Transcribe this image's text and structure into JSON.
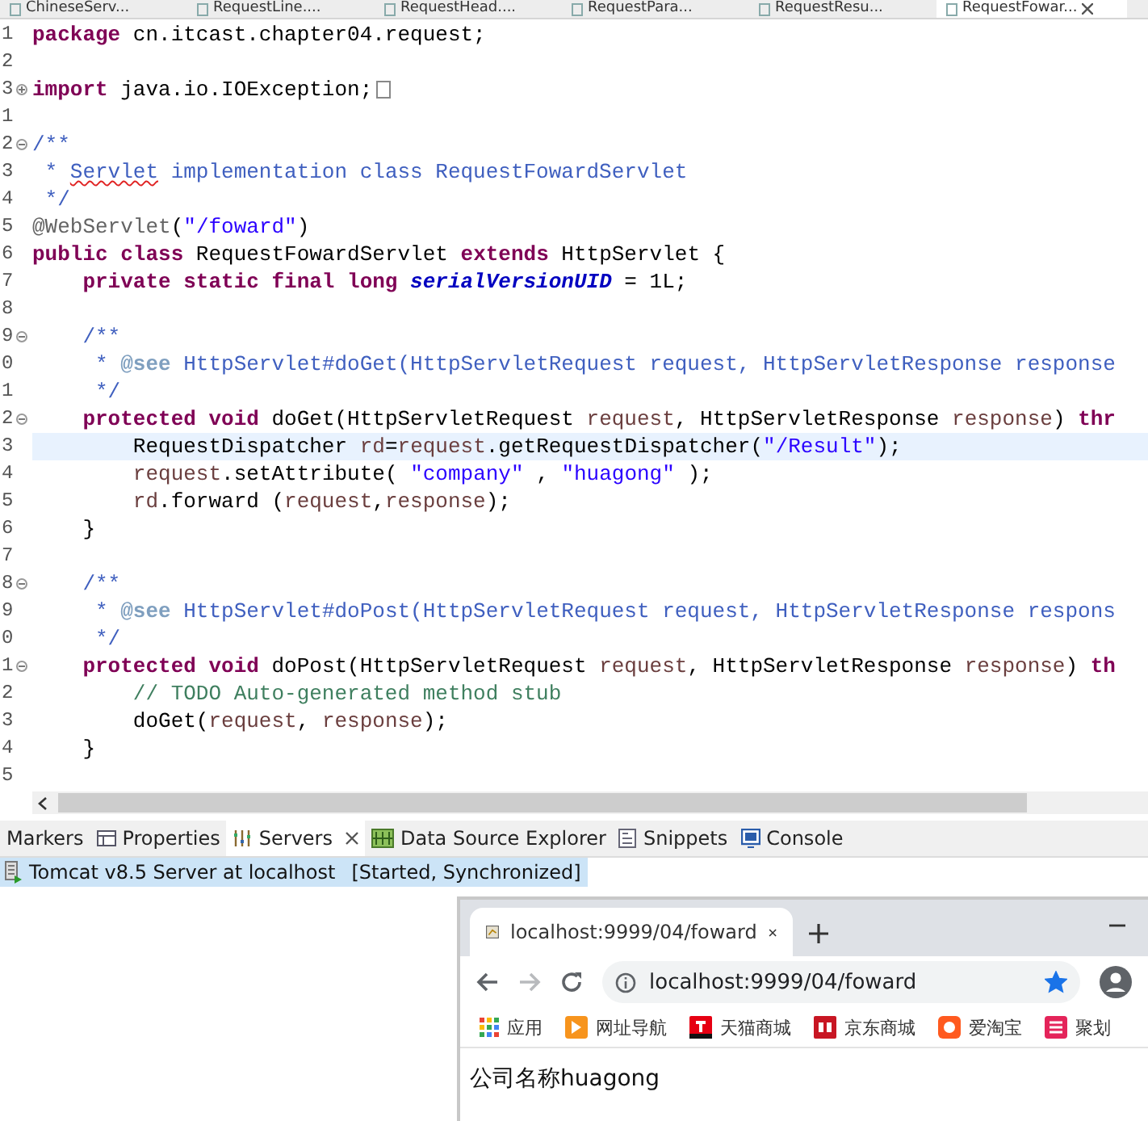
{
  "editor": {
    "tabs": [
      {
        "label": "ChineseServ...",
        "selected": false
      },
      {
        "label": "RequestLine....",
        "selected": false
      },
      {
        "label": "RequestHead....",
        "selected": false
      },
      {
        "label": "RequestPara...",
        "selected": false
      },
      {
        "label": "RequestResu...",
        "selected": false
      },
      {
        "label": "RequestFowar...",
        "selected": true
      }
    ],
    "lines": [
      {
        "number": "1",
        "tokens": [
          {
            "kind": "keyword",
            "text": "package"
          },
          {
            "kind": "plain",
            "text": " cn.itcast.chapter04.request;"
          }
        ]
      },
      {
        "number": "2"
      },
      {
        "number": "3",
        "fold_marker": true,
        "expanded": false,
        "tokens": [
          {
            "kind": "keyword",
            "text": "import"
          },
          {
            "kind": "plain",
            "text": " java.io.IOException;"
          }
        ]
      },
      {
        "number": "1"
      },
      {
        "number": "2",
        "fold_marker": true,
        "expanded": true,
        "tokens": [
          {
            "kind": "javadoc",
            "text": "/**"
          }
        ]
      },
      {
        "number": "3",
        "tokens": [
          {
            "kind": "javadoc",
            "text": " * "
          },
          {
            "kind": "misspelled",
            "text": "Servlet"
          },
          {
            "kind": "javadoc",
            "text": " implementation class RequestFowardServlet"
          }
        ]
      },
      {
        "number": "4",
        "tokens": [
          {
            "kind": "javadoc",
            "text": " */"
          }
        ]
      },
      {
        "number": "5",
        "tokens": [
          {
            "kind": "annotation",
            "text": "@WebServlet"
          },
          {
            "kind": "plain",
            "text": "("
          },
          {
            "kind": "string",
            "text": "\"/foward\""
          },
          {
            "kind": "plain",
            "text": ")"
          }
        ]
      },
      {
        "number": "6",
        "tokens": [
          {
            "kind": "keyword",
            "text": "public class"
          },
          {
            "kind": "plain",
            "text": " RequestFowardServlet "
          },
          {
            "kind": "keyword",
            "text": "extends"
          },
          {
            "kind": "plain",
            "text": " HttpServlet {"
          }
        ]
      },
      {
        "number": "7",
        "tokens": [
          {
            "kind": "keyword",
            "text": "    private static final long "
          },
          {
            "kind": "field",
            "text": "serialVersionUID"
          },
          {
            "kind": "plain",
            "text": " = 1L;"
          }
        ]
      },
      {
        "number": "8"
      },
      {
        "number": "9",
        "fold_marker": true,
        "expanded": true,
        "tokens": [
          {
            "kind": "javadoc",
            "text": "    /**"
          }
        ]
      },
      {
        "number": "0",
        "tokens": [
          {
            "kind": "javadoc",
            "text": "     * "
          },
          {
            "kind": "tag",
            "text": "@see"
          },
          {
            "kind": "javadoc",
            "text": " HttpServlet#doGet(HttpServletRequest request, HttpServletResponse response"
          }
        ]
      },
      {
        "number": "1",
        "tokens": [
          {
            "kind": "javadoc",
            "text": "     */"
          }
        ]
      },
      {
        "number": "2",
        "fold_marker": true,
        "expanded": true,
        "tokens": [
          {
            "kind": "keyword",
            "text": "    protected void"
          },
          {
            "kind": "plain",
            "text": " doGet(HttpServletRequest "
          },
          {
            "kind": "param",
            "text": "request"
          },
          {
            "kind": "plain",
            "text": ", HttpServletResponse "
          },
          {
            "kind": "param",
            "text": "response"
          },
          {
            "kind": "plain",
            "text": ") "
          },
          {
            "kind": "keyword",
            "text": "thr"
          }
        ]
      },
      {
        "number": "3",
        "current": true,
        "tokens": [
          {
            "kind": "plain",
            "text": "        RequestDispatcher "
          },
          {
            "kind": "param",
            "text": "rd"
          },
          {
            "kind": "plain",
            "text": "="
          },
          {
            "kind": "param",
            "text": "request"
          },
          {
            "kind": "plain",
            "text": ".getRequestDispatcher("
          },
          {
            "kind": "string",
            "text": "\"/Result\""
          },
          {
            "kind": "plain",
            "text": ");"
          }
        ]
      },
      {
        "number": "4",
        "tokens": [
          {
            "kind": "param",
            "text": "        request"
          },
          {
            "kind": "plain",
            "text": ".setAttribute( "
          },
          {
            "kind": "string",
            "text": "\"company\""
          },
          {
            "kind": "plain",
            "text": " , "
          },
          {
            "kind": "string",
            "text": "\"huagong\""
          },
          {
            "kind": "plain",
            "text": " );"
          }
        ]
      },
      {
        "number": "5",
        "tokens": [
          {
            "kind": "param",
            "text": "        rd"
          },
          {
            "kind": "plain",
            "text": ".forward ("
          },
          {
            "kind": "param",
            "text": "request"
          },
          {
            "kind": "plain",
            "text": ","
          },
          {
            "kind": "param",
            "text": "response"
          },
          {
            "kind": "plain",
            "text": ");"
          }
        ]
      },
      {
        "number": "6",
        "tokens": [
          {
            "kind": "plain",
            "text": "    }"
          }
        ]
      },
      {
        "number": "7"
      },
      {
        "number": "8",
        "fold_marker": true,
        "expanded": true,
        "tokens": [
          {
            "kind": "javadoc",
            "text": "    /**"
          }
        ]
      },
      {
        "number": "9",
        "tokens": [
          {
            "kind": "javadoc",
            "text": "     * "
          },
          {
            "kind": "tag",
            "text": "@see"
          },
          {
            "kind": "javadoc",
            "text": " HttpServlet#doPost(HttpServletRequest request, HttpServletResponse respons"
          }
        ]
      },
      {
        "number": "0",
        "tokens": [
          {
            "kind": "javadoc",
            "text": "     */"
          }
        ]
      },
      {
        "number": "1",
        "fold_marker": true,
        "expanded": true,
        "tokens": [
          {
            "kind": "keyword",
            "text": "    protected void"
          },
          {
            "kind": "plain",
            "text": " doPost(HttpServletRequest "
          },
          {
            "kind": "param",
            "text": "request"
          },
          {
            "kind": "plain",
            "text": ", HttpServletResponse "
          },
          {
            "kind": "param",
            "text": "response"
          },
          {
            "kind": "plain",
            "text": ") "
          },
          {
            "kind": "keyword",
            "text": "th"
          }
        ]
      },
      {
        "number": "2",
        "tokens": [
          {
            "kind": "comment",
            "text": "        // TODO Auto-generated method stub"
          }
        ]
      },
      {
        "number": "3",
        "tokens": [
          {
            "kind": "plain",
            "text": "        doGet("
          },
          {
            "kind": "param",
            "text": "request"
          },
          {
            "kind": "plain",
            "text": ", "
          },
          {
            "kind": "param",
            "text": "response"
          },
          {
            "kind": "plain",
            "text": ");"
          }
        ]
      },
      {
        "number": "4",
        "tokens": [
          {
            "kind": "plain",
            "text": "    }"
          }
        ]
      },
      {
        "number": "5"
      }
    ]
  },
  "panel": {
    "tabs": [
      {
        "label": "Markers",
        "selected": false
      },
      {
        "label": "Properties",
        "selected": false
      },
      {
        "label": "Servers",
        "selected": true
      },
      {
        "label": "Data Source Explorer",
        "selected": false
      },
      {
        "label": "Snippets",
        "selected": false
      },
      {
        "label": "Console",
        "selected": false
      }
    ],
    "servers": [
      {
        "name": "Tomcat v8.5 Server at localhost",
        "status": "[Started, Synchronized]",
        "selected": true
      }
    ]
  },
  "browser": {
    "tab": {
      "title": "localhost:9999/04/foward"
    },
    "forward_disabled": true,
    "address": {
      "value": "localhost:9999/04/foward"
    },
    "bookmarked": true,
    "bookmarks": [
      "应用",
      "网址导航",
      "天猫商城",
      "京东商城",
      "爱淘宝",
      "聚划"
    ],
    "page_text": "公司名称huagong"
  }
}
